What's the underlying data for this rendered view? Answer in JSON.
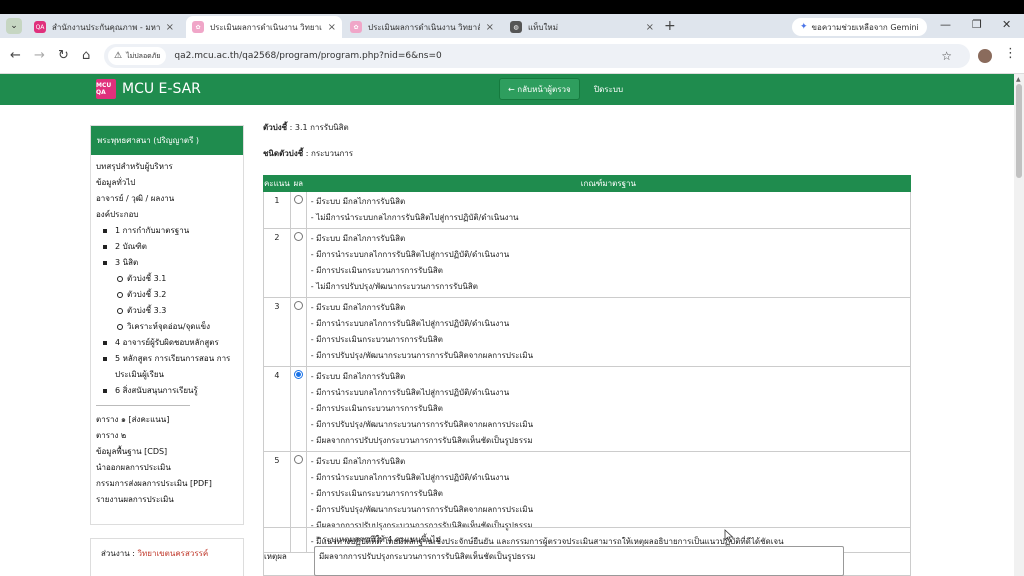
{
  "browser": {
    "tabs": [
      {
        "title": "สำนักงานประกันคุณภาพ - มหาวิทยาลั",
        "active": false,
        "favicon_color": "#e0307c"
      },
      {
        "title": "ประเมินผลการดำเนินงาน วิทยาเขตนค",
        "active": true,
        "favicon_color": "#f0a6c8"
      },
      {
        "title": "ประเมินผลการดำเนินงาน วิทยาลัยสงฆ",
        "active": false,
        "favicon_color": "#f0a6c8"
      },
      {
        "title": "แท็บใหม่",
        "active": false,
        "favicon_color": "#555555"
      }
    ],
    "gemini_label": "ขอความช่วยเหลือจาก Gemini",
    "security_label": "ไม่ปลอดภัย",
    "url": "qa2.mcu.ac.th/qa2568/program/program.php?nid=6&ns=0"
  },
  "navbar": {
    "brand": "MCU E-SAR",
    "logo_text": "MCU QA",
    "back_button": "← กลับหน้าผู้ตรวจ",
    "close_system": "ปิดระบบ",
    "color": "#1f8c4e"
  },
  "sidebar": {
    "header": "พระพุทธศาสนา (ปริญญาตรี )",
    "top_links": [
      "บทสรุปสำหรับผู้บริหาร",
      "ข้อมูลทั่วไป",
      "อาจารย์ / วุฒิ / ผลงาน",
      "องค์ประกอบ"
    ],
    "components": [
      {
        "label": "1 การกำกับมาตรฐาน"
      },
      {
        "label": "2 บัณฑิต"
      },
      {
        "label": "3 นิสิต",
        "sub": [
          "ตัวบ่งชี้ 3.1",
          "ตัวบ่งชี้ 3.2",
          "ตัวบ่งชี้ 3.3",
          "วิเคราะห์จุดอ่อน/จุดแข็ง"
        ]
      },
      {
        "label": "4 อาจารย์ผู้รับผิดชอบหลักสูตร"
      },
      {
        "label": "5 หลักสูตร การเรียนการสอน การประเมินผู้เรียน"
      },
      {
        "label": "6 สิ่งสนับสนุนการเรียนรู้"
      }
    ],
    "bottom_links": [
      "ตาราง ๑ [ส่งคะแนน]",
      "ตาราง ๒",
      "ข้อมูลพื้นฐาน [CDS]",
      "นำออกผลการประเมิน",
      "กรรมการส่งผลการประเมิน [PDF]",
      "รายงานผลการประเมิน"
    ],
    "unit_label": "ส่วนงาน :",
    "unit_value": "วิทยาเขตนครสวรรค์"
  },
  "main": {
    "indicator_label": "ตัวบ่งชี้",
    "indicator_value": ": 3.1 การรับนิสิต",
    "type_label": "ชนิดตัวบ่งชี้",
    "type_value": ": กระบวนการ",
    "table": {
      "headers": [
        "คะแนน",
        "ผล",
        "เกณฑ์มาตรฐาน"
      ],
      "rows": [
        {
          "score": "1",
          "selected": false,
          "criteria": [
            "- มีระบบ มีกลไกการรับนิสิต",
            "- ไม่มีการนำระบบกลไกการรับนิสิตไปสู่การปฏิบัติ/ดำเนินงาน"
          ]
        },
        {
          "score": "2",
          "selected": false,
          "criteria": [
            "- มีระบบ มีกลไกการรับนิสิต",
            "- มีการนำระบบกลไกการรับนิสิตไปสู่การปฏิบัติ/ดำเนินงาน",
            "- มีการประเมินกระบวนการการรับนิสิต",
            "- ไม่มีการปรับปรุง/พัฒนากระบวนการการรับนิสิต"
          ]
        },
        {
          "score": "3",
          "selected": false,
          "criteria": [
            "- มีระบบ มีกลไกการรับนิสิต",
            "- มีการนำระบบกลไกการรับนิสิตไปสู่การปฏิบัติ/ดำเนินงาน",
            "- มีการประเมินกระบวนการการรับนิสิต",
            "- มีการปรับปรุง/พัฒนากระบวนการการรับนิสิตจากผลการประเมิน"
          ]
        },
        {
          "score": "4",
          "selected": true,
          "criteria": [
            "- มีระบบ มีกลไกการรับนิสิต",
            "- มีการนำระบบกลไกการรับนิสิตไปสู่การปฏิบัติ/ดำเนินงาน",
            "- มีการประเมินกระบวนการการรับนิสิต",
            "- มีการปรับปรุง/พัฒนากระบวนการการรับนิสิตจากผลการประเมิน",
            "- มีผลจากการปรับปรุงกระบวนการการรับนิสิตเห็นชัดเป็นรูปธรรม"
          ]
        },
        {
          "score": "5",
          "selected": false,
          "criteria": [
            "- มีระบบ มีกลไกการรับนิสิต",
            "- มีการนำระบบกลไกการรับนิสิตไปสู่การปฏิบัติ/ดำเนินงาน",
            "- มีการประเมินกระบวนการการรับนิสิต",
            "- มีการปรับปรุง/พัฒนากระบวนการการรับนิสิตจากผลการประเมิน",
            "- มีผลจากการปรับปรุงกระบวนการการรับนิสิตเห็นชัดเป็นรูปธรรม",
            "- มีแนวทางปฏิบัติที่ดี โดยมีหลักฐานเชิงประจักษ์ยืนยัน และกรรมการผู้ตรวจประเมินสามารถให้เหตุผลอธิบายการเป็นแนวปฏิบัติที่ดีได้ชัดเจน"
          ]
        }
      ]
    },
    "reason_label": "เหตุผล",
    "reason_note": "* ระบุเหตุผลกรณีให้ 4 คะแนนขึ้นไป",
    "reason_value": "มีผลจากการปรับปรุงกระบวนการการรับนิสิตเห็นชัดเป็นรูปธรรม"
  }
}
